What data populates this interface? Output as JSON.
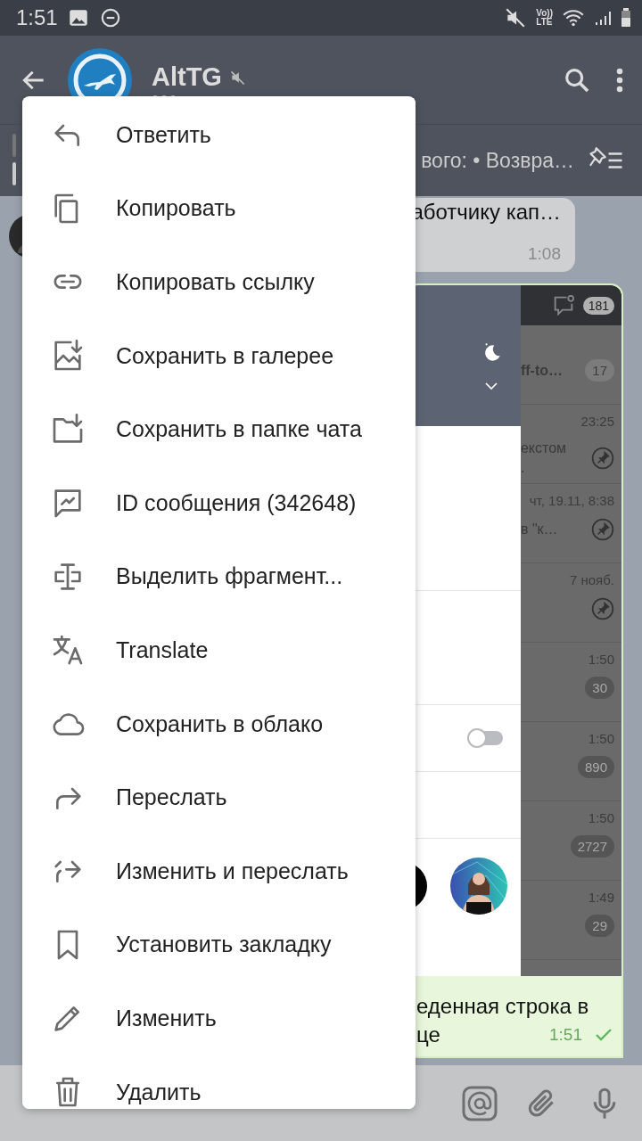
{
  "status_bar": {
    "time": "1:51",
    "volte_lines": [
      "Vo))",
      "LTE"
    ]
  },
  "header": {
    "title": "AltTG",
    "muted": true
  },
  "pinned": {
    "text": "вого: • Возвра…"
  },
  "messages": [
    {
      "kind": "incoming",
      "text": "аботчику кап…",
      "time": "1:08"
    },
    {
      "kind": "outgoing",
      "sent": true,
      "text_lines": [
        "еденная строка в",
        "це"
      ],
      "time": "1:51",
      "screenshot": {
        "badge": "181",
        "toggle": {
          "on": false
        },
        "rows": [
          {
            "lines": [
              "ff-to…"
            ],
            "badge": "17"
          },
          {
            "time": "23:25",
            "lines": [
              "екстом",
              "."
            ],
            "pinned": true
          },
          {
            "time": "чт, 19.11, 8:38",
            "lines": [
              "в \"к…"
            ],
            "pinned": true
          },
          {
            "time": "7 нояб.",
            "pinned": true
          },
          {
            "time": "1:50",
            "badge": "30"
          },
          {
            "time": "1:50",
            "badge": "890"
          },
          {
            "time": "1:50",
            "badge": "2727"
          },
          {
            "time": "1:49",
            "badge": "29"
          }
        ]
      }
    }
  ],
  "menu": [
    {
      "kind": "reply",
      "label": "Ответить"
    },
    {
      "kind": "copy",
      "label": "Копировать"
    },
    {
      "kind": "link",
      "label": "Копировать ссылку"
    },
    {
      "kind": "gallery",
      "label": "Сохранить в галерее"
    },
    {
      "kind": "folder",
      "label": "Сохранить в папке чата"
    },
    {
      "kind": "msgid",
      "label": "ID сообщения (342648)"
    },
    {
      "kind": "select",
      "label": "Выделить фрагмент..."
    },
    {
      "kind": "translate",
      "label": "Translate"
    },
    {
      "kind": "cloud",
      "label": "Сохранить в облако"
    },
    {
      "kind": "forward",
      "label": "Переслать"
    },
    {
      "kind": "editforward",
      "label": "Изменить и переслать"
    },
    {
      "kind": "bookmark",
      "label": "Установить закладку"
    },
    {
      "kind": "edit",
      "label": "Изменить"
    },
    {
      "kind": "delete",
      "label": "Удалить"
    }
  ]
}
